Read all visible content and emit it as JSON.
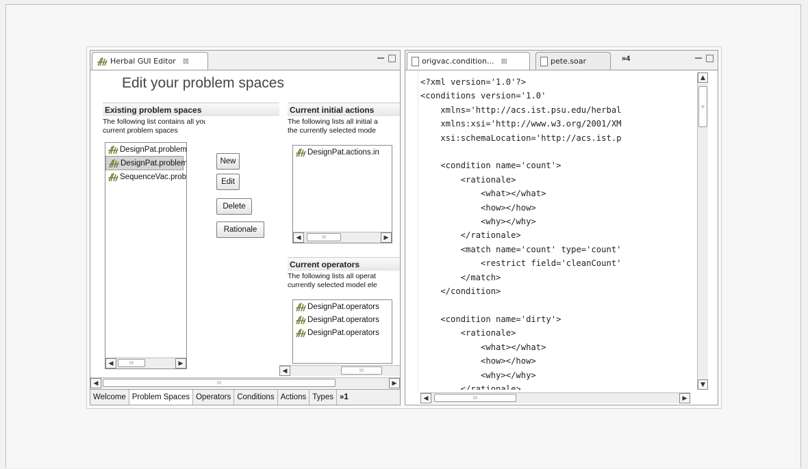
{
  "left_panel": {
    "tab_title": "Herbal GUI Editor",
    "page_title": "Edit your problem spaces",
    "existing": {
      "heading": "Existing problem spaces",
      "desc_line1": "The following list contains all your",
      "desc_line2": "current problem spaces",
      "items": [
        "DesignPat.problemsp",
        "DesignPat.problemsp",
        "SequenceVac.proble"
      ],
      "selected_index": 1
    },
    "buttons": {
      "new": "New",
      "edit": "Edit",
      "delete": "Delete",
      "rationale": "Rationale"
    },
    "initial_actions": {
      "heading": "Current initial actions",
      "desc_line1": "The following lists all initial a",
      "desc_line2": "the currently selected mode",
      "items": [
        "DesignPat.actions.in"
      ]
    },
    "operators": {
      "heading": "Current operators",
      "desc_line1": "The following lists all operat",
      "desc_line2": "currently selected model ele",
      "items": [
        "DesignPat.operators",
        "DesignPat.operators",
        "DesignPat.operators"
      ]
    },
    "bottom_tabs": [
      "Welcome",
      "Problem Spaces",
      "Operators",
      "Conditions",
      "Actions",
      "Types"
    ],
    "bottom_overflow": "»1",
    "active_bottom_tab": "Problem Spaces",
    "scroll_grip": "III"
  },
  "right_panel": {
    "tab1": "origvac.condition...",
    "tab2": "pete.soar",
    "overflow": "»4",
    "code_lines": [
      "<?xml version='1.0'?>",
      "<conditions version='1.0'",
      "    xmlns='http://acs.ist.psu.edu/herbal",
      "    xmlns:xsi='http://www.w3.org/2001/XM",
      "    xsi:schemaLocation='http://acs.ist.p",
      "",
      "    <condition name='count'>",
      "        <rationale>",
      "            <what></what>",
      "            <how></how>",
      "            <why></why>",
      "        </rationale>",
      "        <match name='count' type='count'",
      "            <restrict field='cleanCount'",
      "        </match>",
      "    </condition>",
      "",
      "    <condition name='dirty'>",
      "        <rationale>",
      "            <what></what>",
      "            <how></how>",
      "            <why></why>",
      "        </rationale>"
    ]
  },
  "colors": {
    "background": "#f1f1f1",
    "selection": "#d4d4d4",
    "border": "#9a9a9a"
  }
}
